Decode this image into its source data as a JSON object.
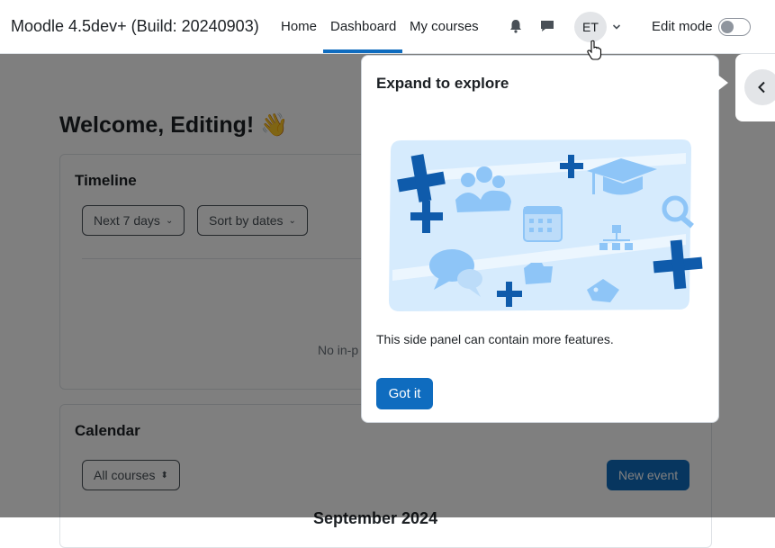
{
  "navbar": {
    "brand": "Moodle 4.5dev+ (Build: 20240903)",
    "links": [
      "Home",
      "Dashboard",
      "My courses"
    ],
    "active_link": "Dashboard",
    "notifications_icon": "bell-icon",
    "messages_icon": "chat-bubble-icon",
    "user_initials": "ET",
    "user_menu_icon": "chevron-down-icon",
    "edit_mode_label": "Edit mode",
    "edit_mode_on": false
  },
  "page": {
    "welcome": "Welcome, Editing! 👋",
    "timeline": {
      "title": "Timeline",
      "filter_label": "Next 7 days",
      "sort_label": "Sort by dates",
      "empty_text": "No in-p"
    },
    "calendar": {
      "title": "Calendar",
      "course_select": "All courses",
      "new_event_label": "New event",
      "month_label": "September 2024"
    }
  },
  "drawer_toggle": {
    "icon": "chevron-left-icon"
  },
  "popover": {
    "title": "Expand to explore",
    "illustration": "side-panel-illustration",
    "body": "This side panel can contain more features.",
    "button_label": "Got it"
  },
  "colors": {
    "primary": "#0f6cbf",
    "illustration_bg": "#d6ebfd",
    "illustration_accent": "#0f5bab"
  }
}
